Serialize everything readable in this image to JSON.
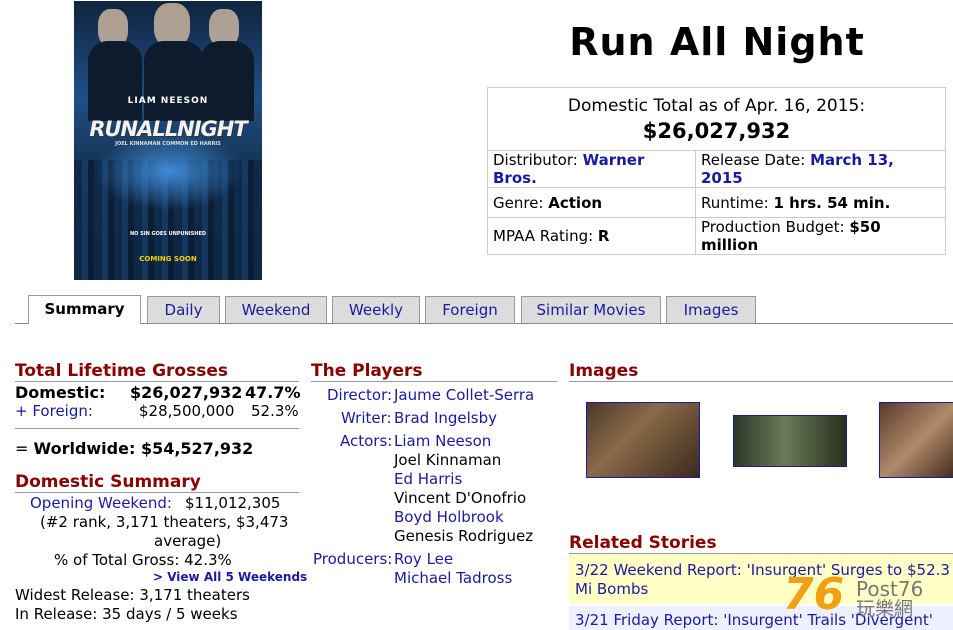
{
  "poster": {
    "star": "LIAM NEESON",
    "title": "RUNALLNIGHT",
    "cast_line": "JOEL KINNAMAN   COMMON   ED HARRIS",
    "tagline": "NO SIN GOES UNPUNISHED",
    "coming": "COMING SOON"
  },
  "title": "Run All Night",
  "info": {
    "total_label": "Domestic Total as of Apr. 16, 2015:",
    "total_value": "$26,027,932",
    "distributor_label": "Distributor: ",
    "distributor": "Warner Bros.",
    "release_label": "Release Date: ",
    "release": "March 13, 2015",
    "genre_label": "Genre: ",
    "genre": "Action",
    "runtime_label": "Runtime: ",
    "runtime": "1 hrs. 54 min.",
    "mpaa_label": "MPAA Rating: ",
    "mpaa": "R",
    "budget_label": "Production Budget: ",
    "budget": "$50 million"
  },
  "tabs": [
    "Summary",
    "Daily",
    "Weekend",
    "Weekly",
    "Foreign",
    "Similar Movies",
    "Images"
  ],
  "grosses": {
    "title": "Total Lifetime Grosses",
    "domestic_label": "Domestic:",
    "domestic_value": "$26,027,932",
    "domestic_pct": "47.7%",
    "foreign_label": "+ Foreign:",
    "foreign_value": "$28,500,000",
    "foreign_pct": "52.3%",
    "worldwide_prefix": "= ",
    "worldwide_label": "Worldwide: $54,527,932"
  },
  "domestic_summary": {
    "title": "Domestic Summary",
    "opening_label": "Opening Weekend:",
    "opening_value": "$11,012,305",
    "opening_detail_1": "(#2 rank, 3,171 theaters, $3,473",
    "opening_detail_2": "average)",
    "pct_total": "% of Total Gross: 42.3%",
    "view_all": "> View All 5 Weekends",
    "widest": "Widest Release: 3,171 theaters",
    "in_release": "In Release: 35 days / 5 weeks"
  },
  "players": {
    "title": "The Players",
    "director_label": "Director:",
    "director": "Jaume Collet-Serra",
    "writer_label": "Writer:",
    "writer": "Brad Ingelsby",
    "actors_label": "Actors:",
    "actors": [
      {
        "name": "Liam Neeson",
        "link": true
      },
      {
        "name": "Joel Kinnaman",
        "link": false
      },
      {
        "name": "Ed Harris",
        "link": true
      },
      {
        "name": "Vincent D'Onofrio",
        "link": false
      },
      {
        "name": "Boyd Holbrook",
        "link": true
      },
      {
        "name": "Genesis Rodriguez",
        "link": false
      }
    ],
    "producers_label": "Producers:",
    "producers": [
      "Roy Lee",
      "Michael Tadross"
    ]
  },
  "images_title": "Images",
  "related": {
    "title": "Related Stories",
    "stories": [
      "3/22 Weekend Report: 'Insurgent' Surges to $52.3 Mi Bombs",
      "3/21 Friday Report: 'Insurgent' Trails 'Divergent'"
    ]
  },
  "watermark": {
    "number": "76",
    "brand": "Post76",
    "chinese": "玩樂網"
  },
  "colors": {
    "link": "#1a1aa0",
    "section": "#8b0000",
    "story_bg": "#ffffc6"
  }
}
